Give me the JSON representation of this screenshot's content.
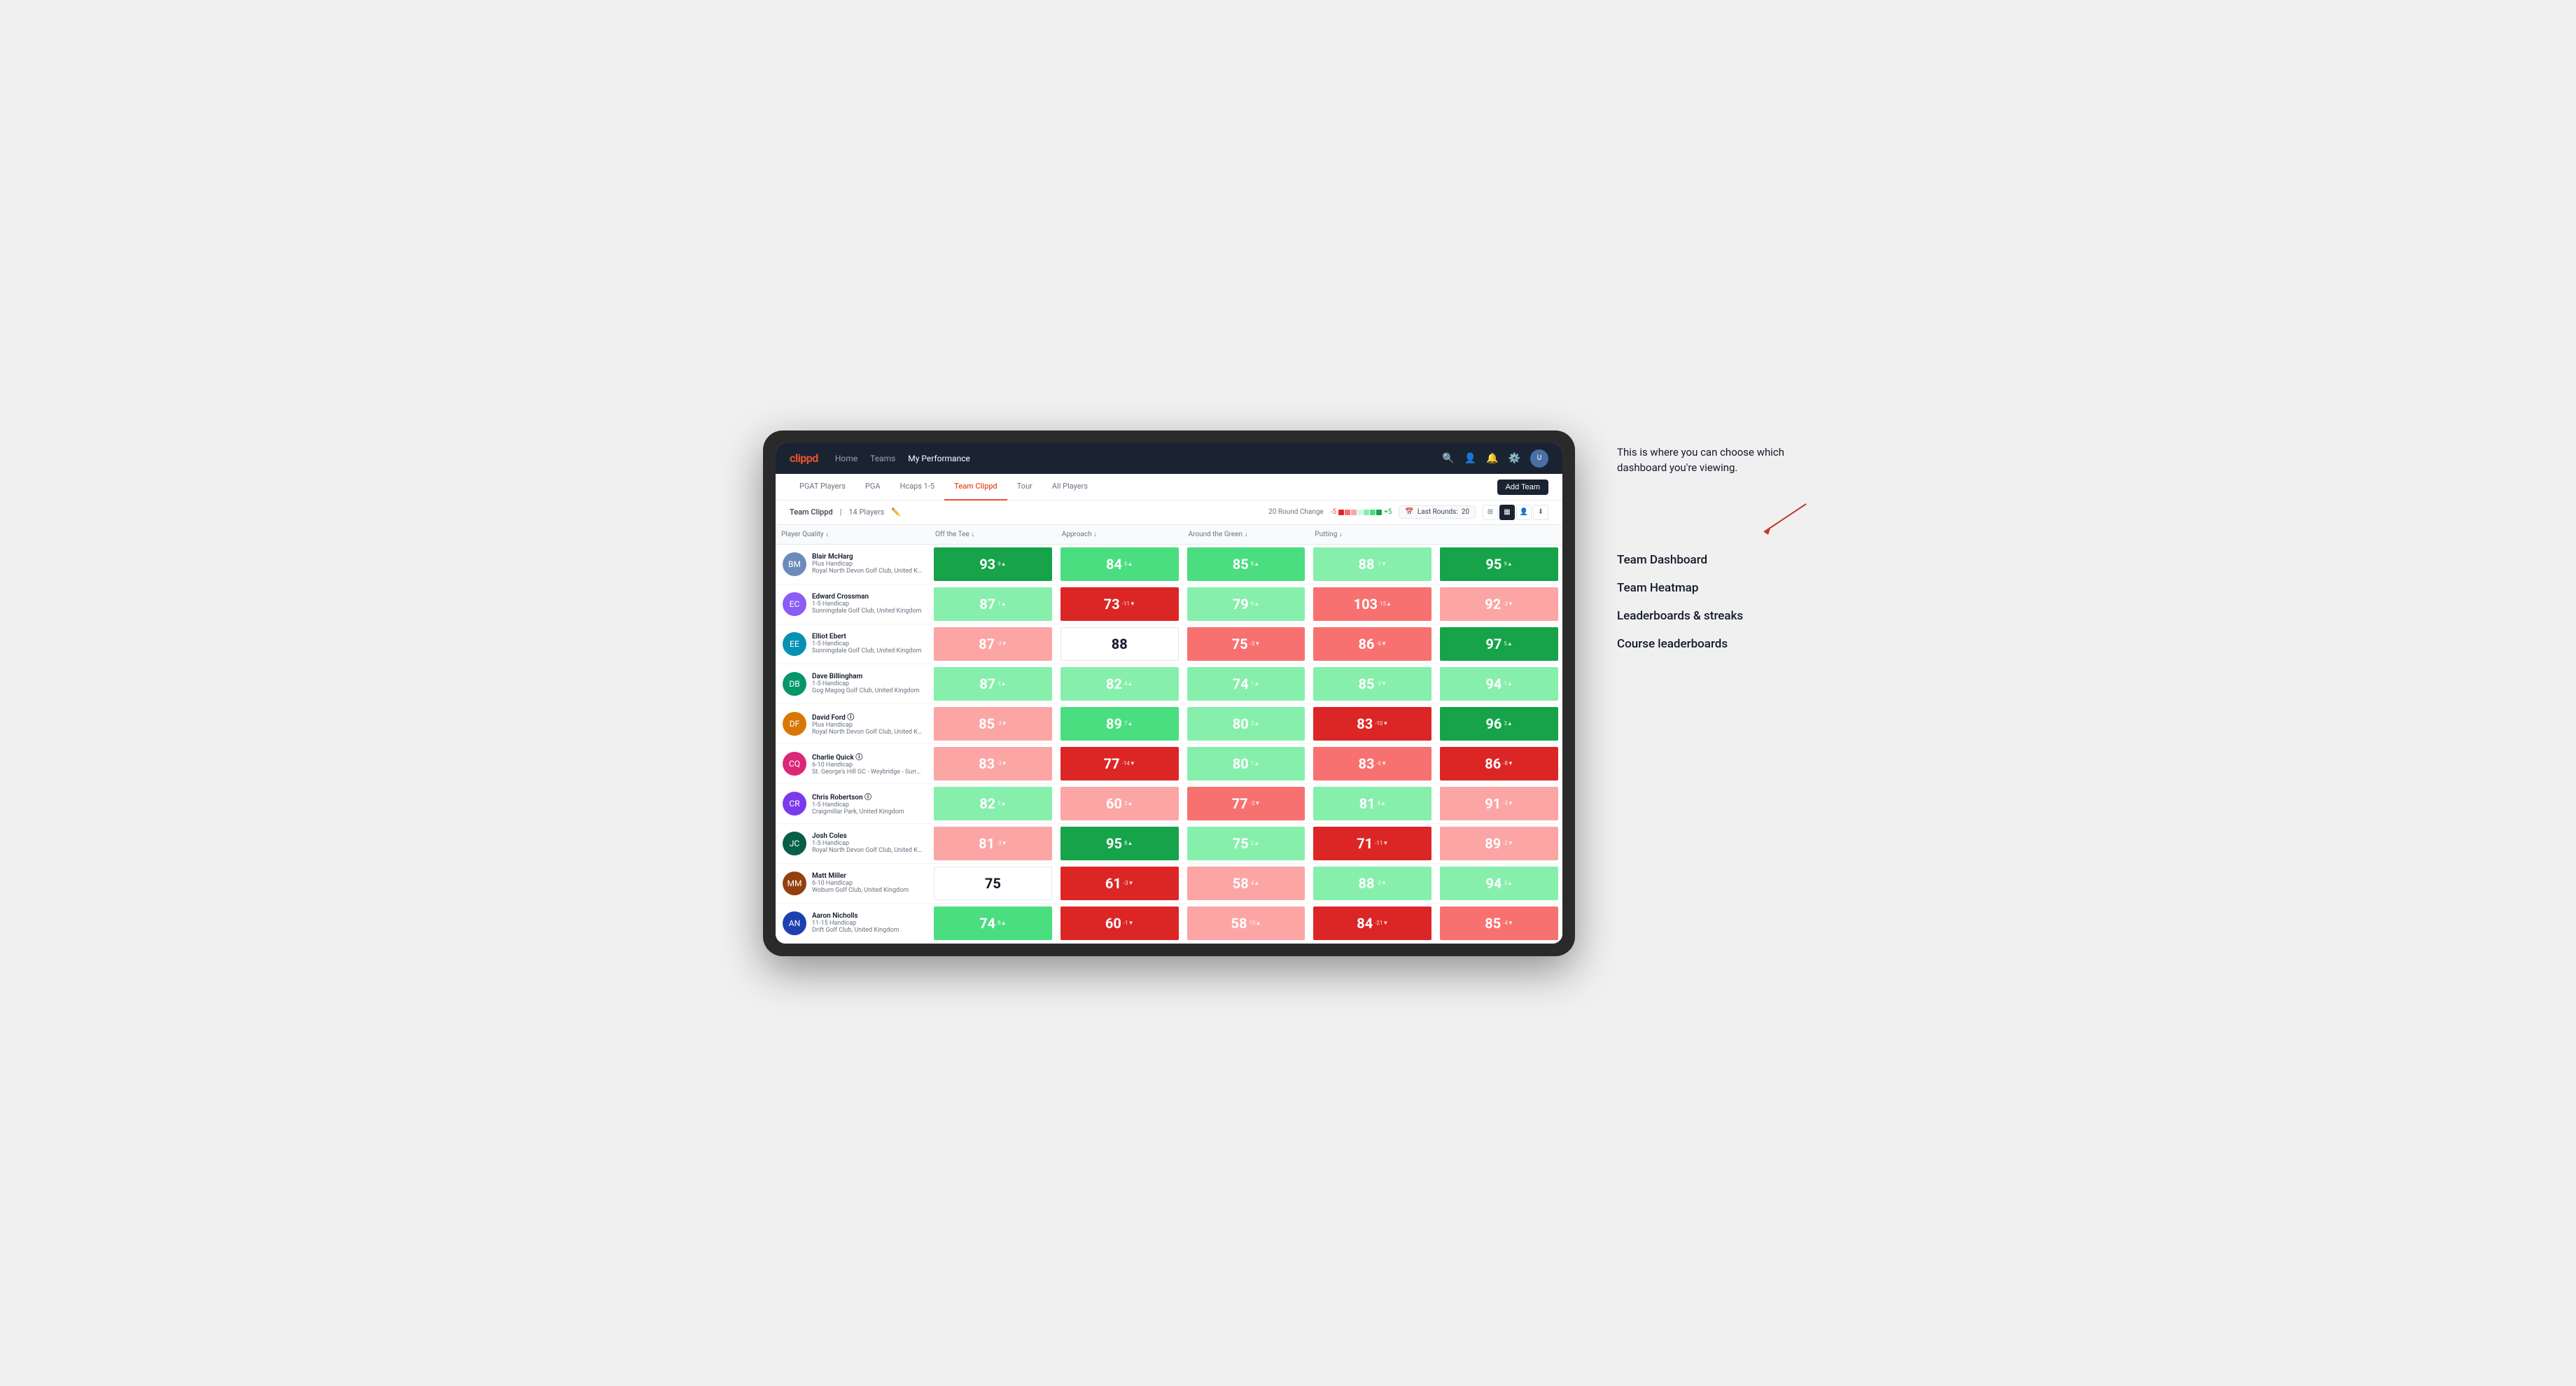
{
  "nav": {
    "logo": "clippd",
    "links": [
      "Home",
      "Teams",
      "My Performance"
    ],
    "active_link": "My Performance",
    "icons": [
      "🔍",
      "👤",
      "🔔",
      "⚙️"
    ]
  },
  "tabs": {
    "items": [
      "PGAT Players",
      "PGA",
      "Hcaps 1-5",
      "Team Clippd",
      "Tour",
      "All Players"
    ],
    "active": "Team Clippd",
    "add_btn": "Add Team"
  },
  "subheader": {
    "team_name": "Team Clippd",
    "separator": "|",
    "count": "14 Players",
    "round_change_label": "20 Round Change",
    "neg_val": "-5",
    "pos_val": "+5",
    "last_rounds_label": "Last Rounds:",
    "last_rounds_value": "20"
  },
  "table": {
    "columns": [
      "Player Quality ↓",
      "Off the Tee ↓",
      "Approach ↓",
      "Around the Green ↓",
      "Putting ↓"
    ],
    "rows": [
      {
        "name": "Blair McHarg",
        "handicap": "Plus Handicap",
        "club": "Royal North Devon Golf Club, United Kingdom",
        "initials": "BM",
        "scores": [
          {
            "value": 93,
            "change": "9▲",
            "bg": "bg-green-strong",
            "dark": false
          },
          {
            "value": 84,
            "change": "6▲",
            "bg": "bg-green-mid",
            "dark": false
          },
          {
            "value": 85,
            "change": "8▲",
            "bg": "bg-green-mid",
            "dark": false
          },
          {
            "value": 88,
            "change": "-1▼",
            "bg": "bg-green-light",
            "dark": false
          },
          {
            "value": 95,
            "change": "9▲",
            "bg": "bg-green-strong",
            "dark": false
          }
        ]
      },
      {
        "name": "Edward Crossman",
        "handicap": "1-5 Handicap",
        "club": "Sunningdale Golf Club, United Kingdom",
        "initials": "EC",
        "scores": [
          {
            "value": 87,
            "change": "1▲",
            "bg": "bg-green-light",
            "dark": false
          },
          {
            "value": 73,
            "change": "-11▼",
            "bg": "bg-red-strong",
            "dark": false
          },
          {
            "value": 79,
            "change": "9▲",
            "bg": "bg-green-light",
            "dark": false
          },
          {
            "value": 103,
            "change": "15▲",
            "bg": "bg-red-mid",
            "dark": false
          },
          {
            "value": 92,
            "change": "-3▼",
            "bg": "bg-red-light",
            "dark": false
          }
        ]
      },
      {
        "name": "Elliot Ebert",
        "handicap": "1-5 Handicap",
        "club": "Sunningdale Golf Club, United Kingdom",
        "initials": "EE",
        "scores": [
          {
            "value": 87,
            "change": "-3▼",
            "bg": "bg-red-light",
            "dark": false
          },
          {
            "value": 88,
            "change": "",
            "bg": "bg-white",
            "dark": true
          },
          {
            "value": 75,
            "change": "-3▼",
            "bg": "bg-red-mid",
            "dark": false
          },
          {
            "value": 86,
            "change": "-6▼",
            "bg": "bg-red-mid",
            "dark": false
          },
          {
            "value": 97,
            "change": "5▲",
            "bg": "bg-green-strong",
            "dark": false
          }
        ]
      },
      {
        "name": "Dave Billingham",
        "handicap": "1-5 Handicap",
        "club": "Gog Magog Golf Club, United Kingdom",
        "initials": "DB",
        "scores": [
          {
            "value": 87,
            "change": "4▲",
            "bg": "bg-green-light",
            "dark": false
          },
          {
            "value": 82,
            "change": "4▲",
            "bg": "bg-green-light",
            "dark": false
          },
          {
            "value": 74,
            "change": "1▲",
            "bg": "bg-green-light",
            "dark": false
          },
          {
            "value": 85,
            "change": "-3▼",
            "bg": "bg-green-light",
            "dark": false
          },
          {
            "value": 94,
            "change": "1▲",
            "bg": "bg-green-light",
            "dark": false
          }
        ]
      },
      {
        "name": "David Ford",
        "handicap": "Plus Handicap",
        "club": "Royal North Devon Golf Club, United Kingdom",
        "initials": "DF",
        "has_icon": true,
        "scores": [
          {
            "value": 85,
            "change": "-3▼",
            "bg": "bg-red-light",
            "dark": false
          },
          {
            "value": 89,
            "change": "7▲",
            "bg": "bg-green-mid",
            "dark": false
          },
          {
            "value": 80,
            "change": "3▲",
            "bg": "bg-green-light",
            "dark": false
          },
          {
            "value": 83,
            "change": "-10▼",
            "bg": "bg-red-strong",
            "dark": false
          },
          {
            "value": 96,
            "change": "3▲",
            "bg": "bg-green-strong",
            "dark": false
          }
        ]
      },
      {
        "name": "Charlie Quick",
        "handicap": "6-10 Handicap",
        "club": "St. George's Hill GC - Weybridge - Surrey, Uni...",
        "initials": "CQ",
        "has_icon": true,
        "scores": [
          {
            "value": 83,
            "change": "-3▼",
            "bg": "bg-red-light",
            "dark": false
          },
          {
            "value": 77,
            "change": "-14▼",
            "bg": "bg-red-strong",
            "dark": false
          },
          {
            "value": 80,
            "change": "1▲",
            "bg": "bg-green-light",
            "dark": false
          },
          {
            "value": 83,
            "change": "-6▼",
            "bg": "bg-red-mid",
            "dark": false
          },
          {
            "value": 86,
            "change": "-8▼",
            "bg": "bg-red-strong",
            "dark": false
          }
        ]
      },
      {
        "name": "Chris Robertson",
        "handicap": "1-5 Handicap",
        "club": "Craigmillar Park, United Kingdom",
        "initials": "CR",
        "has_icon": true,
        "scores": [
          {
            "value": 82,
            "change": "3▲",
            "bg": "bg-green-light",
            "dark": false
          },
          {
            "value": 60,
            "change": "2▲",
            "bg": "bg-red-light",
            "dark": false
          },
          {
            "value": 77,
            "change": "-3▼",
            "bg": "bg-red-mid",
            "dark": false
          },
          {
            "value": 81,
            "change": "4▲",
            "bg": "bg-green-light",
            "dark": false
          },
          {
            "value": 91,
            "change": "-3▼",
            "bg": "bg-red-light",
            "dark": false
          }
        ]
      },
      {
        "name": "Josh Coles",
        "handicap": "1-5 Handicap",
        "club": "Royal North Devon Golf Club, United Kingdom",
        "initials": "JC",
        "scores": [
          {
            "value": 81,
            "change": "-3▼",
            "bg": "bg-red-light",
            "dark": false
          },
          {
            "value": 95,
            "change": "8▲",
            "bg": "bg-green-strong",
            "dark": false
          },
          {
            "value": 75,
            "change": "2▲",
            "bg": "bg-green-light",
            "dark": false
          },
          {
            "value": 71,
            "change": "-11▼",
            "bg": "bg-red-strong",
            "dark": false
          },
          {
            "value": 89,
            "change": "-2▼",
            "bg": "bg-red-light",
            "dark": false
          }
        ]
      },
      {
        "name": "Matt Miller",
        "handicap": "6-10 Handicap",
        "club": "Woburn Golf Club, United Kingdom",
        "initials": "MM",
        "scores": [
          {
            "value": 75,
            "change": "",
            "bg": "bg-white",
            "dark": true
          },
          {
            "value": 61,
            "change": "-3▼",
            "bg": "bg-red-strong",
            "dark": false
          },
          {
            "value": 58,
            "change": "4▲",
            "bg": "bg-red-light",
            "dark": false
          },
          {
            "value": 88,
            "change": "-2▼",
            "bg": "bg-green-light",
            "dark": false
          },
          {
            "value": 94,
            "change": "3▲",
            "bg": "bg-green-light",
            "dark": false
          }
        ]
      },
      {
        "name": "Aaron Nicholls",
        "handicap": "11-15 Handicap",
        "club": "Drift Golf Club, United Kingdom",
        "initials": "AN",
        "scores": [
          {
            "value": 74,
            "change": "8▲",
            "bg": "bg-green-mid",
            "dark": false
          },
          {
            "value": 60,
            "change": "-1▼",
            "bg": "bg-red-strong",
            "dark": false
          },
          {
            "value": 58,
            "change": "10▲",
            "bg": "bg-red-light",
            "dark": false
          },
          {
            "value": 84,
            "change": "-21▼",
            "bg": "bg-red-strong",
            "dark": false
          },
          {
            "value": 85,
            "change": "-4▼",
            "bg": "bg-red-mid",
            "dark": false
          }
        ]
      }
    ]
  },
  "annotation": {
    "text": "This is where you can choose which dashboard you're viewing.",
    "options": [
      "Team Dashboard",
      "Team Heatmap",
      "Leaderboards & streaks",
      "Course leaderboards"
    ]
  }
}
